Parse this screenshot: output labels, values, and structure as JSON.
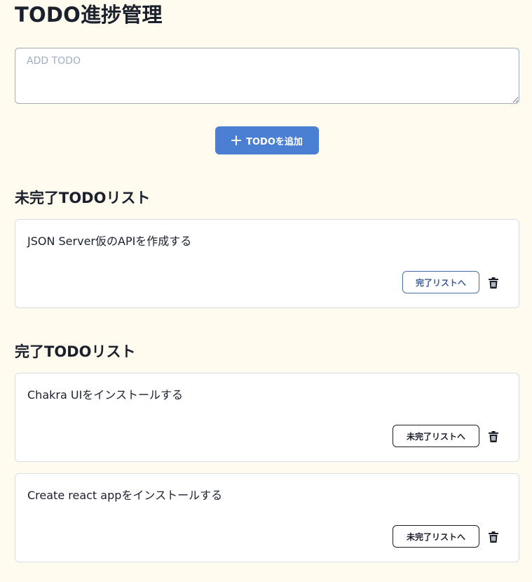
{
  "app": {
    "title": "TODO進捗管理"
  },
  "input": {
    "placeholder": "ADD TODO",
    "value": ""
  },
  "add_button": {
    "label": "TODOを追加",
    "icon": "plus-icon"
  },
  "incomplete": {
    "heading": "未完了TODOリスト",
    "items": [
      {
        "text": "JSON Server仮のAPIを作成する",
        "action_label": "完了リストへ",
        "delete_icon": "trash-icon"
      }
    ]
  },
  "complete": {
    "heading": "完了TODOリスト",
    "items": [
      {
        "text": "Chakra UIをインストールする",
        "action_label": "未完了リストへ",
        "delete_icon": "trash-icon"
      },
      {
        "text": "Create react appをインストールする",
        "action_label": "未完了リストへ",
        "delete_icon": "trash-icon"
      }
    ]
  },
  "colors": {
    "background": "#fffcef",
    "primary_button": "#4a7fd4",
    "complete_action": "#3d5f94",
    "text": "#1a202c"
  }
}
